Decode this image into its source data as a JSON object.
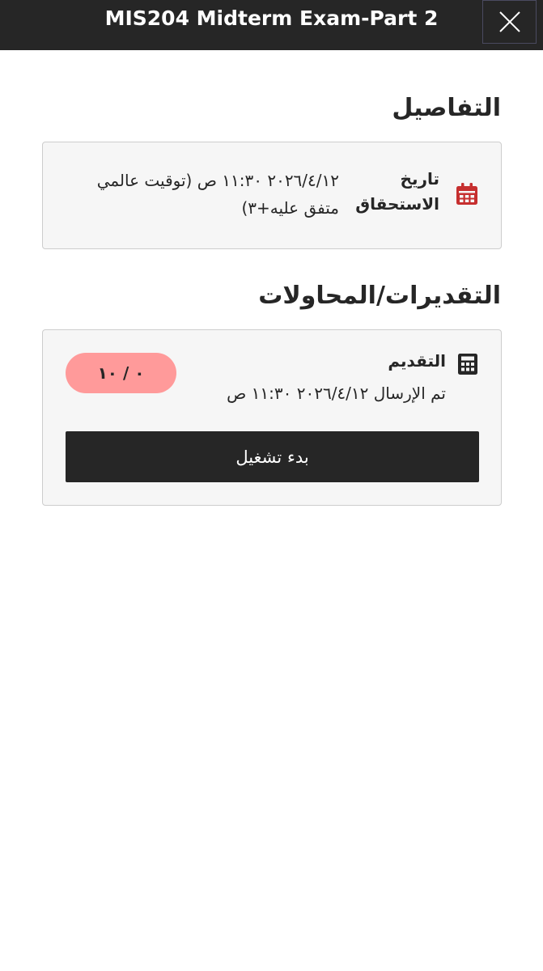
{
  "header": {
    "title": "MIS204 Midterm Exam-Part 2",
    "close_icon": "close-icon"
  },
  "details": {
    "heading": "التفاصيل",
    "due_date": {
      "icon": "calendar-icon",
      "icon_color": "#c62f2f",
      "label_line1": "تاريخ",
      "label_line2": "الاستحقاق",
      "value_line1": "٢٠٢٦/٤/١٢ ١١:٣٠ ص (توقيت عالمي",
      "value_line2": "متفق عليه+٣)"
    }
  },
  "grades": {
    "heading": "التقديرات/المحاولات",
    "submission": {
      "icon": "calculator-icon",
      "label": "التقديم",
      "status": "تم الإرسال ٢٠٢٦/٤/١٢ ١١:٣٠ ص",
      "grade": "٠ / ١٠",
      "grade_color": "#ff9a9a"
    },
    "start_button_label": "بدء تشغيل"
  }
}
